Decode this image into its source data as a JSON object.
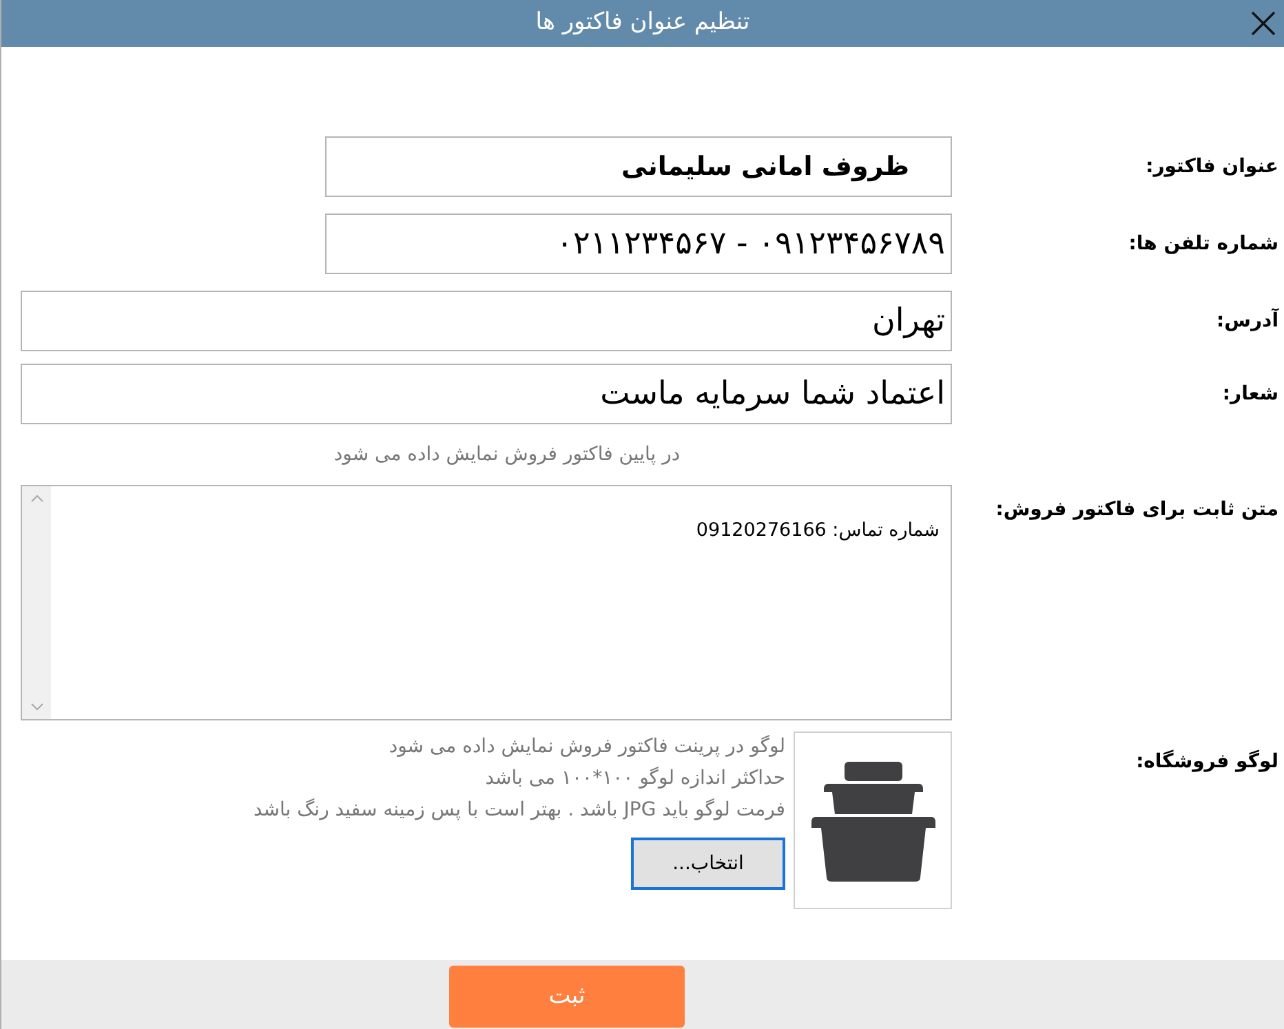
{
  "window": {
    "title": "تنظیم عنوان فاکتور ها"
  },
  "fields": [
    {
      "label": "عنوان فاکتور:",
      "value": "ظروف امانی سلیمانی",
      "kind": "heading"
    },
    {
      "label": "شماره تلفن ها:",
      "value": "۰۹۱۲۳۴۵۶۷۸۹ - ۰۲۱۱۲۳۴۵۶۷",
      "kind": "short"
    },
    {
      "label": "آدرس:",
      "value": "تهران",
      "kind": "wide"
    },
    {
      "label": "شعار:",
      "value": "اعتماد شما سرمایه ماست",
      "kind": "wide"
    }
  ],
  "slogan_note": "در پایین فاکتور فروش نمایش داده می شود",
  "fixed_text": {
    "label": "متن ثابت برای فاکتور فروش:",
    "value": "شماره تماس: 09120276166"
  },
  "logo": {
    "label": "لوگو فروشگاه:",
    "notes": [
      "لوگو در پرینت فاکتور فروش نمایش داده می شود",
      "حداکثر اندازه لوگو ۱۰۰*۱۰۰ می باشد",
      "فرمت لوگو باید JPG باشد . بهتر است با پس زمینه سفید رنگ باشد"
    ],
    "choose_button": {
      "label": "انتخاب...",
      "focused": true
    }
  },
  "submit_button": "ثبت"
}
